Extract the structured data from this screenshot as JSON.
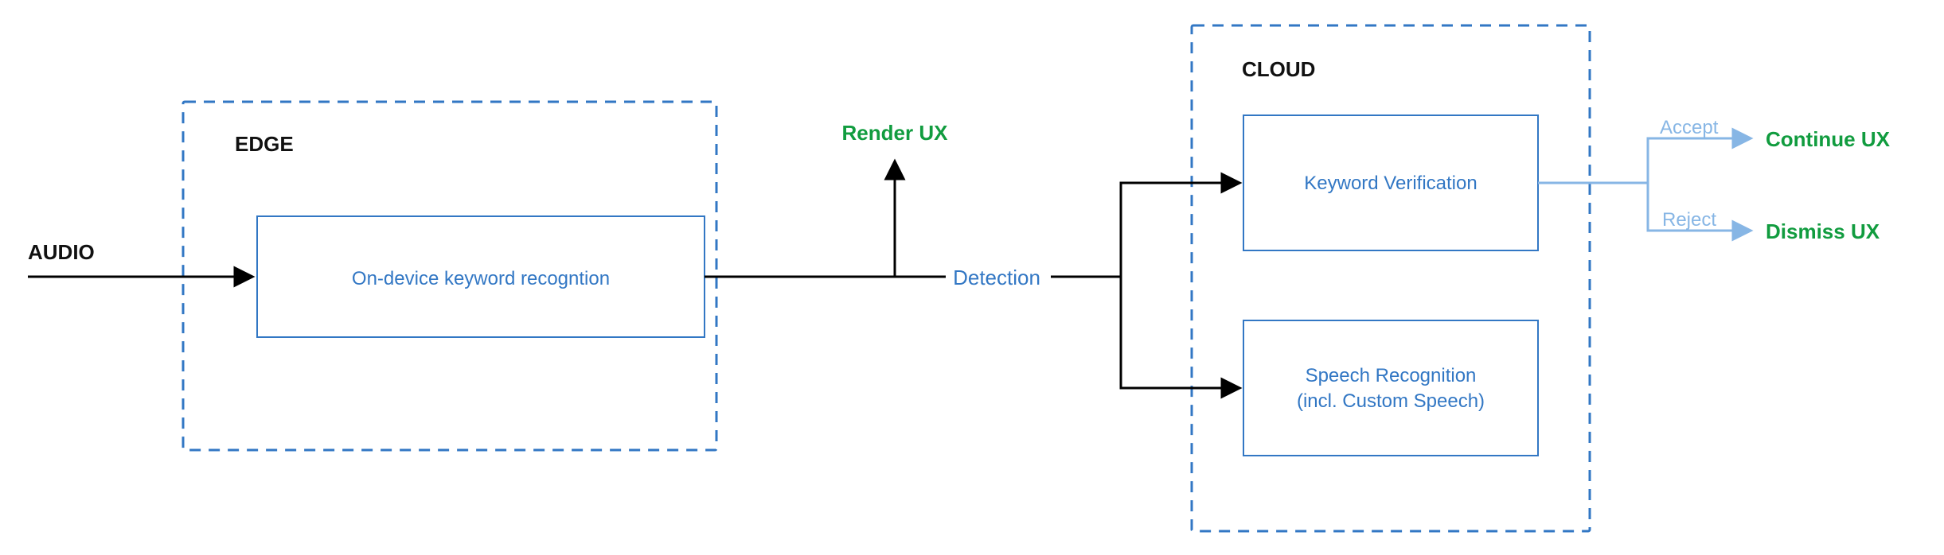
{
  "groups": {
    "edge": {
      "label": "EDGE"
    },
    "cloud": {
      "label": "CLOUD"
    }
  },
  "inputs": {
    "audio": {
      "label": "AUDIO"
    }
  },
  "nodes": {
    "odk": {
      "label": "On-device keyword recogntion"
    },
    "kv": {
      "label": "Keyword Verification"
    },
    "sr": {
      "line1": "Speech Recognition",
      "line2": "(incl. Custom Speech)"
    }
  },
  "edges": {
    "detection": {
      "label": "Detection"
    },
    "render": {
      "label": "Render UX"
    },
    "accept": {
      "label": "Accept"
    },
    "reject": {
      "label": "Reject"
    }
  },
  "outputs": {
    "continue": {
      "label": "Continue UX"
    },
    "dismiss": {
      "label": "Dismiss UX"
    }
  },
  "diagram": {
    "description": "Audio enters an edge device where on-device keyword recognition runs. On detection, the UX is rendered locally while audio is forwarded to the cloud. In the cloud, keyword verification either accepts (continue UX) or rejects (dismiss UX), and speech recognition (including Custom Speech) processes the utterance."
  }
}
